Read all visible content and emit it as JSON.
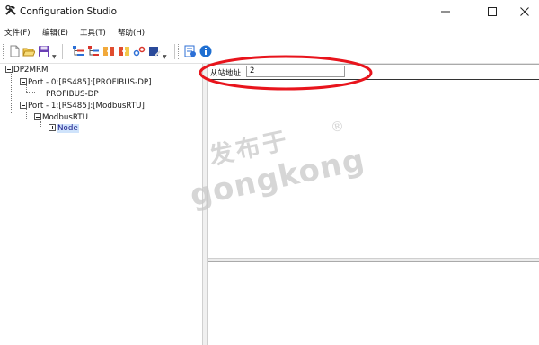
{
  "window": {
    "title": "Configuration Studio",
    "icon": "hammer-wrench-icon",
    "controls": [
      "minimize-icon",
      "maximize-icon",
      "close-icon"
    ]
  },
  "menu": {
    "items": [
      "文件(F)",
      "编辑(E)",
      "工具(T)",
      "帮助(H)"
    ]
  },
  "toolbar": {
    "buttons": [
      "new-icon",
      "open-icon",
      "save-icon",
      "tree-expand-icon",
      "tree-collapse-icon",
      "import-icon",
      "export-icon",
      "link-icon",
      "edit-icon",
      "validate-icon",
      "info-icon"
    ]
  },
  "tree": {
    "root": "DP2MRM",
    "port0": "Port - 0:[RS485]:[PROFIBUS-DP]",
    "port0_child": "PROFIBUS-DP",
    "port1": "Port - 1:[RS485]:[ModbusRTU]",
    "port1_child": "ModbusRTU",
    "node": "Node"
  },
  "properties": {
    "slave_address_label": "从站地址",
    "slave_address_value": "2"
  },
  "watermark": {
    "cn": "发布于",
    "en": "gongkong",
    "mark": "®"
  },
  "colors": {
    "annotation": "#e8141c",
    "selection_bg": "#cfe3fb",
    "save_icon": "#6a3fb5",
    "info_icon": "#1f6fd1"
  }
}
